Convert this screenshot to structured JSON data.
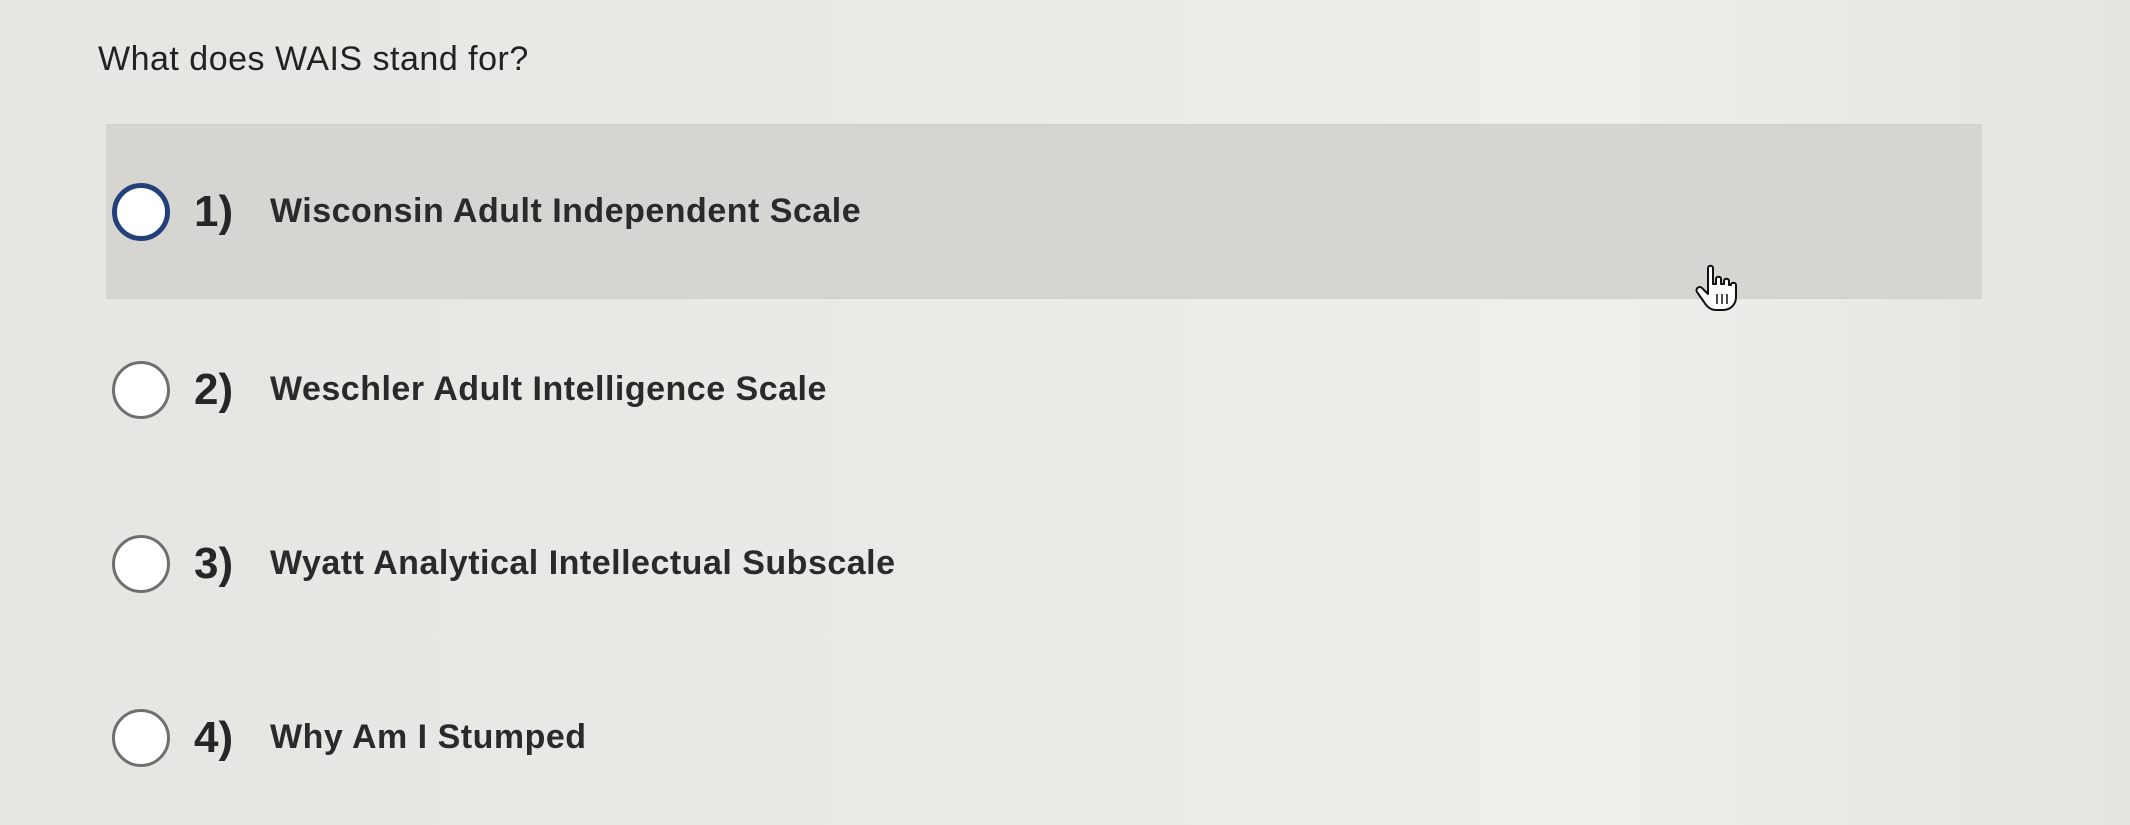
{
  "question": {
    "text": "What does WAIS stand for?"
  },
  "options": [
    {
      "number": "1)",
      "label": "Wisconsin Adult Independent Scale",
      "highlighted": true
    },
    {
      "number": "2)",
      "label": "Weschler Adult Intelligence Scale",
      "highlighted": false
    },
    {
      "number": "3)",
      "label": "Wyatt Analytical Intellectual Subscale",
      "highlighted": false
    },
    {
      "number": "4)",
      "label": "Why Am I Stumped",
      "highlighted": false
    }
  ],
  "icons": {
    "radio": "radio-button-icon",
    "cursor": "hand-pointer-icon"
  },
  "colors": {
    "highlight_background": "#d6d5d1",
    "selected_radio_border": "#23407a"
  }
}
